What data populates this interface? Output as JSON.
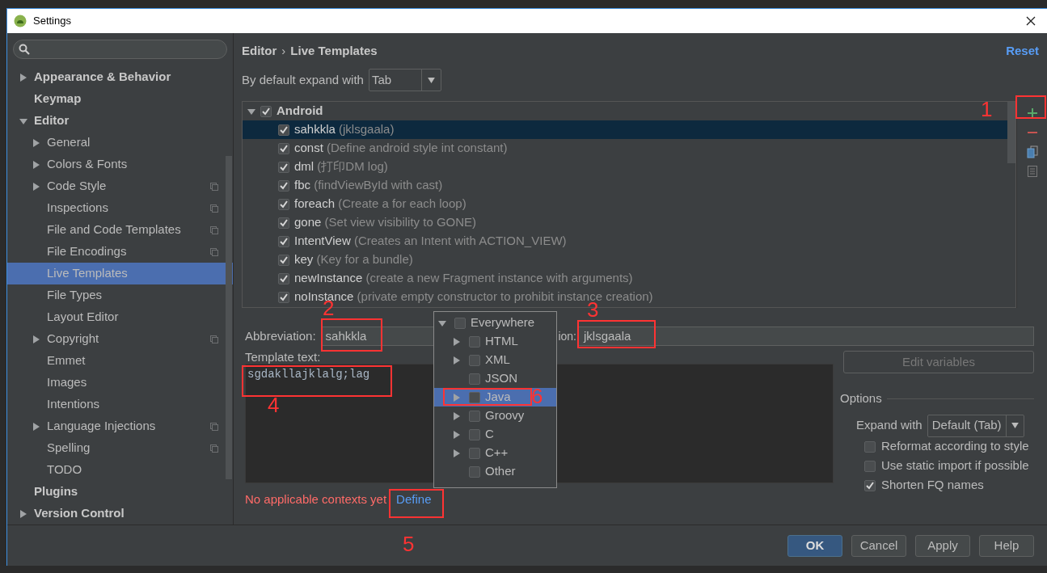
{
  "window": {
    "title": "Settings"
  },
  "sidebar": {
    "items": [
      {
        "label": "Appearance & Behavior",
        "expandable": true,
        "expanded": false,
        "shared": false,
        "selected": false
      },
      {
        "label": "Keymap",
        "expandable": false,
        "shared": false,
        "selected": false
      },
      {
        "label": "Editor",
        "expandable": true,
        "expanded": true,
        "shared": false,
        "selected": false,
        "children": [
          {
            "label": "General",
            "expandable": true,
            "expanded": false,
            "shared": false,
            "selected": false
          },
          {
            "label": "Colors & Fonts",
            "expandable": true,
            "expanded": false,
            "shared": false,
            "selected": false
          },
          {
            "label": "Code Style",
            "expandable": true,
            "expanded": false,
            "shared": true,
            "selected": false
          },
          {
            "label": "Inspections",
            "expandable": false,
            "shared": true,
            "selected": false
          },
          {
            "label": "File and Code Templates",
            "expandable": false,
            "shared": true,
            "selected": false
          },
          {
            "label": "File Encodings",
            "expandable": false,
            "shared": true,
            "selected": false
          },
          {
            "label": "Live Templates",
            "expandable": false,
            "shared": false,
            "selected": true
          },
          {
            "label": "File Types",
            "expandable": false,
            "shared": false,
            "selected": false
          },
          {
            "label": "Layout Editor",
            "expandable": false,
            "shared": false,
            "selected": false
          },
          {
            "label": "Copyright",
            "expandable": true,
            "expanded": false,
            "shared": true,
            "selected": false
          },
          {
            "label": "Emmet",
            "expandable": false,
            "shared": false,
            "selected": false
          },
          {
            "label": "Images",
            "expandable": false,
            "shared": false,
            "selected": false
          },
          {
            "label": "Intentions",
            "expandable": false,
            "shared": false,
            "selected": false
          },
          {
            "label": "Language Injections",
            "expandable": true,
            "expanded": false,
            "shared": true,
            "selected": false
          },
          {
            "label": "Spelling",
            "expandable": false,
            "shared": true,
            "selected": false
          },
          {
            "label": "TODO",
            "expandable": false,
            "shared": false,
            "selected": false
          }
        ]
      },
      {
        "label": "Plugins",
        "expandable": false,
        "shared": false,
        "selected": false
      },
      {
        "label": "Version Control",
        "expandable": true,
        "expanded": false,
        "shared": false,
        "selected": false
      }
    ]
  },
  "header": {
    "breadcrumb": [
      "Editor",
      "Live Templates"
    ],
    "separator": "›",
    "reset": "Reset"
  },
  "expand_default": {
    "label": "By default expand with",
    "value": "Tab"
  },
  "templates": {
    "groups": [
      {
        "name": "Android",
        "checked": true,
        "expanded": true,
        "children": [
          {
            "name": "sahkkla",
            "description": "(jklsgaala)",
            "checked": true,
            "selected": true
          },
          {
            "name": "const",
            "description": "(Define android style int constant)",
            "checked": true,
            "selected": false
          },
          {
            "name": "dml",
            "description": "(打印DM  log)",
            "checked": true,
            "selected": false
          },
          {
            "name": "fbc",
            "description": "(findViewById with cast)",
            "checked": true,
            "selected": false
          },
          {
            "name": "foreach",
            "description": "(Create a for each loop)",
            "checked": true,
            "selected": false
          },
          {
            "name": "gone",
            "description": "(Set view visibility to GONE)",
            "checked": true,
            "selected": false
          },
          {
            "name": "IntentView",
            "description": "(Creates an Intent with ACTION_VIEW)",
            "checked": true,
            "selected": false
          },
          {
            "name": "key",
            "description": "(Key for a bundle)",
            "checked": true,
            "selected": false
          },
          {
            "name": "newInstance",
            "description": "(create a new Fragment instance with arguments)",
            "checked": true,
            "selected": false
          },
          {
            "name": "noInstance",
            "description": "(private empty constructor to prohibit instance creation)",
            "checked": true,
            "selected": false
          }
        ]
      }
    ]
  },
  "toolbar": [
    {
      "kind": "add"
    },
    {
      "kind": "remove"
    },
    {
      "kind": "copy"
    },
    {
      "kind": "edit"
    }
  ],
  "editor": {
    "abbreviation_label": "Abbreviation:",
    "abbreviation": "sahkkla",
    "description_label": "ion:",
    "description": "jklsgaala",
    "template_label": "Template text:",
    "template_text": "sgdakllajklalg;lag",
    "edit_variables": {
      "label": "Edit variables",
      "disabled": true
    }
  },
  "options": {
    "title": "Options",
    "expand_label": "Expand with",
    "expand_value": "Default (Tab)",
    "checkboxes": [
      {
        "label": "Reformat according to style",
        "checked": false
      },
      {
        "label": "Use static import if possible",
        "checked": false
      },
      {
        "label": "Shorten FQ names",
        "checked": true
      }
    ]
  },
  "context": {
    "message": "No applicable contexts yet",
    "link": "Define"
  },
  "context_popup": {
    "items": [
      {
        "name": "Everywhere",
        "checked": false,
        "expandable": true,
        "expanded": true,
        "selected": false,
        "children": [
          {
            "name": "HTML",
            "checked": false,
            "expandable": true,
            "expanded": false,
            "selected": false
          },
          {
            "name": "XML",
            "checked": false,
            "expandable": true,
            "expanded": false,
            "selected": false
          },
          {
            "name": "JSON",
            "checked": false,
            "expandable": false,
            "selected": false
          },
          {
            "name": "Java",
            "checked": false,
            "expandable": true,
            "expanded": false,
            "selected": true
          },
          {
            "name": "Groovy",
            "checked": false,
            "expandable": true,
            "expanded": false,
            "selected": false
          },
          {
            "name": "C",
            "checked": false,
            "expandable": true,
            "expanded": false,
            "selected": false
          },
          {
            "name": "C++",
            "checked": false,
            "expandable": true,
            "expanded": false,
            "selected": false
          },
          {
            "name": "Other",
            "checked": false,
            "expandable": false,
            "selected": false
          }
        ]
      }
    ]
  },
  "buttons": [
    {
      "label": "OK",
      "default": true
    },
    {
      "label": "Cancel",
      "default": false
    },
    {
      "label": "Apply",
      "default": false
    },
    {
      "label": "Help",
      "default": false
    }
  ],
  "annotations": [
    {
      "label": "1"
    },
    {
      "label": "2"
    },
    {
      "label": "3"
    },
    {
      "label": "4"
    },
    {
      "label": "5"
    },
    {
      "label": "6"
    }
  ]
}
